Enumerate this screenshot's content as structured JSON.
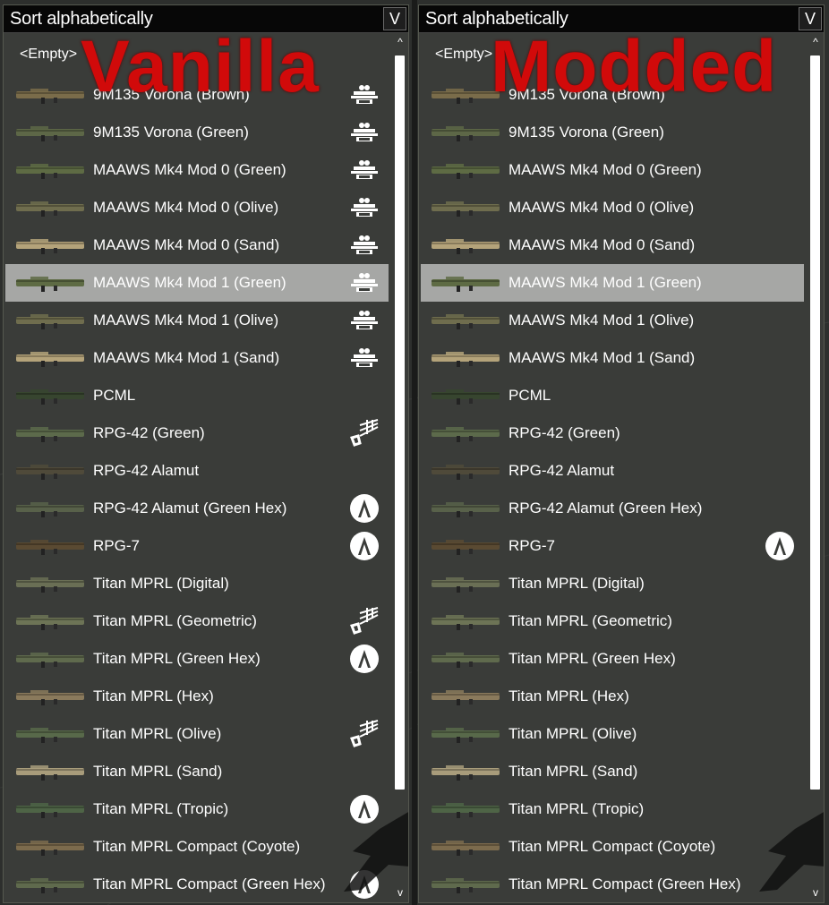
{
  "panels": [
    {
      "id": "left",
      "watermark": "Vanilla",
      "sort_label": "Sort alphabetically",
      "sort_toggle": "V",
      "empty_label": "<Empty>",
      "scroll_up": "^",
      "scroll_down": "v",
      "items": [
        {
          "label": "9M135 Vorona (Brown)",
          "thumb": "#7a6c4a",
          "icon": "contact"
        },
        {
          "label": "9M135 Vorona (Green)",
          "thumb": "#5d6747",
          "icon": "contact"
        },
        {
          "label": "MAAWS Mk4 Mod 0 (Green)",
          "thumb": "#5e6b44",
          "icon": "contact"
        },
        {
          "label": "MAAWS Mk4 Mod 0 (Olive)",
          "thumb": "#6f6d4e",
          "icon": "contact"
        },
        {
          "label": "MAAWS Mk4 Mod 0 (Sand)",
          "thumb": "#b4a37a",
          "icon": "contact"
        },
        {
          "label": "MAAWS Mk4 Mod 1 (Green)",
          "thumb": "#5e6b44",
          "icon": "contact",
          "selected": true
        },
        {
          "label": "MAAWS Mk4 Mod 1 (Olive)",
          "thumb": "#6f6d4e",
          "icon": "contact"
        },
        {
          "label": "MAAWS Mk4 Mod 1 (Sand)",
          "thumb": "#b4a37a",
          "icon": "contact"
        },
        {
          "label": "PCML",
          "thumb": "#37452f",
          "icon": ""
        },
        {
          "label": "RPG-42 (Green)",
          "thumb": "#5c6a4b",
          "icon": "tanoa"
        },
        {
          "label": "RPG-42 Alamut",
          "thumb": "#4f4a3a",
          "icon": ""
        },
        {
          "label": "RPG-42 Alamut (Green Hex)",
          "thumb": "#58614a",
          "icon": "apex"
        },
        {
          "label": "RPG-7",
          "thumb": "#5a4a32",
          "icon": "apex"
        },
        {
          "label": "Titan MPRL (Digital)",
          "thumb": "#6a6f55",
          "icon": ""
        },
        {
          "label": "Titan MPRL (Geometric)",
          "thumb": "#6d7456",
          "icon": "tanoa"
        },
        {
          "label": "Titan MPRL (Green Hex)",
          "thumb": "#5f6a4d",
          "icon": "apex"
        },
        {
          "label": "Titan MPRL (Hex)",
          "thumb": "#8a7a5c",
          "icon": ""
        },
        {
          "label": "Titan MPRL (Olive)",
          "thumb": "#58694a",
          "icon": "tanoa"
        },
        {
          "label": "Titan MPRL (Sand)",
          "thumb": "#a89c7b",
          "icon": ""
        },
        {
          "label": "Titan MPRL (Tropic)",
          "thumb": "#4e6446",
          "icon": "apex"
        },
        {
          "label": "Titan MPRL Compact (Coyote)",
          "thumb": "#7c6b4d",
          "icon": ""
        },
        {
          "label": "Titan MPRL Compact (Green Hex)",
          "thumb": "#5f6a4d",
          "icon": "apex"
        }
      ]
    },
    {
      "id": "right",
      "watermark": "Modded",
      "sort_label": "Sort alphabetically",
      "sort_toggle": "V",
      "empty_label": "<Empty>",
      "scroll_up": "^",
      "scroll_down": "v",
      "items": [
        {
          "label": "9M135 Vorona (Brown)",
          "thumb": "#7a6c4a",
          "icon": ""
        },
        {
          "label": "9M135 Vorona (Green)",
          "thumb": "#5d6747",
          "icon": ""
        },
        {
          "label": "MAAWS Mk4 Mod 0 (Green)",
          "thumb": "#5e6b44",
          "icon": ""
        },
        {
          "label": "MAAWS Mk4 Mod 0 (Olive)",
          "thumb": "#6f6d4e",
          "icon": ""
        },
        {
          "label": "MAAWS Mk4 Mod 0 (Sand)",
          "thumb": "#b4a37a",
          "icon": ""
        },
        {
          "label": "MAAWS Mk4 Mod 1 (Green)",
          "thumb": "#5e6b44",
          "icon": "",
          "selected": true
        },
        {
          "label": "MAAWS Mk4 Mod 1 (Olive)",
          "thumb": "#6f6d4e",
          "icon": ""
        },
        {
          "label": "MAAWS Mk4 Mod 1 (Sand)",
          "thumb": "#b4a37a",
          "icon": ""
        },
        {
          "label": "PCML",
          "thumb": "#37452f",
          "icon": ""
        },
        {
          "label": "RPG-42 (Green)",
          "thumb": "#5c6a4b",
          "icon": ""
        },
        {
          "label": "RPG-42 Alamut",
          "thumb": "#4f4a3a",
          "icon": ""
        },
        {
          "label": "RPG-42 Alamut (Green Hex)",
          "thumb": "#58614a",
          "icon": ""
        },
        {
          "label": "RPG-7",
          "thumb": "#5a4a32",
          "icon": "apex"
        },
        {
          "label": "Titan MPRL (Digital)",
          "thumb": "#6a6f55",
          "icon": ""
        },
        {
          "label": "Titan MPRL (Geometric)",
          "thumb": "#6d7456",
          "icon": ""
        },
        {
          "label": "Titan MPRL (Green Hex)",
          "thumb": "#5f6a4d",
          "icon": ""
        },
        {
          "label": "Titan MPRL (Hex)",
          "thumb": "#8a7a5c",
          "icon": ""
        },
        {
          "label": "Titan MPRL (Olive)",
          "thumb": "#58694a",
          "icon": ""
        },
        {
          "label": "Titan MPRL (Sand)",
          "thumb": "#a89c7b",
          "icon": ""
        },
        {
          "label": "Titan MPRL (Tropic)",
          "thumb": "#4e6446",
          "icon": ""
        },
        {
          "label": "Titan MPRL Compact (Coyote)",
          "thumb": "#7c6b4d",
          "icon": ""
        },
        {
          "label": "Titan MPRL Compact (Green Hex)",
          "thumb": "#5f6a4d",
          "icon": ""
        }
      ]
    }
  ],
  "colors": {
    "watermark": "#d10a0a",
    "selected_row": "#a6a7a5",
    "panel_bg": "#3a3c39",
    "sortbar_bg": "#070707"
  }
}
